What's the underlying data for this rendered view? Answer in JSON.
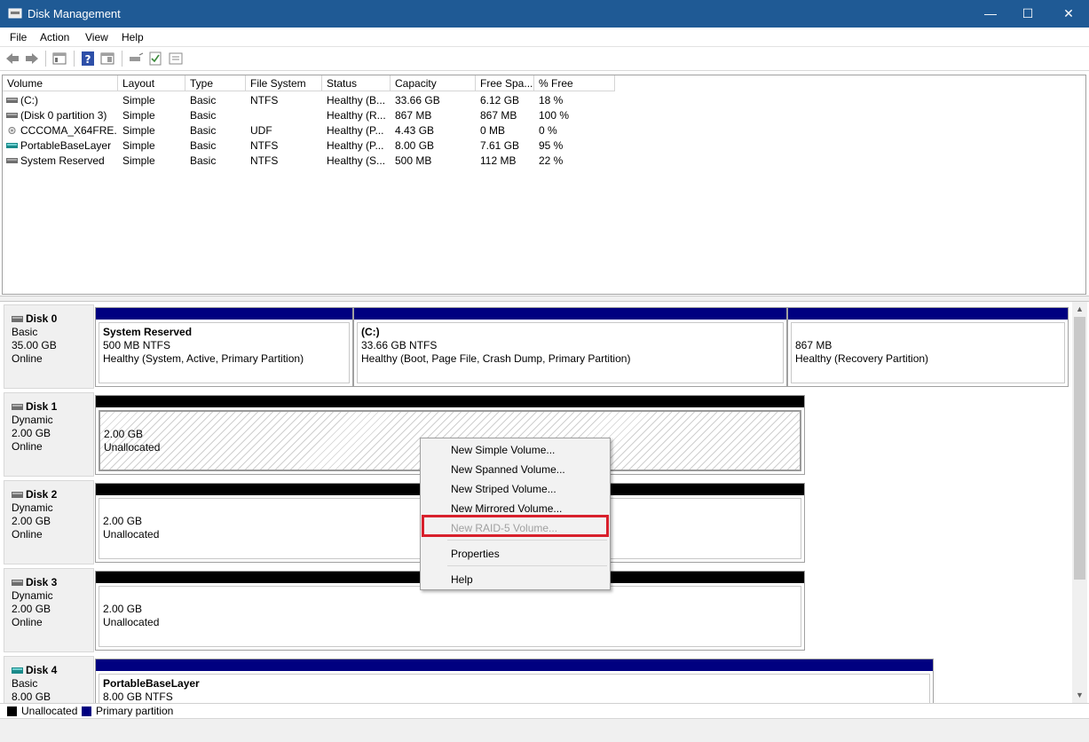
{
  "window": {
    "title": "Disk Management",
    "minimize": "—",
    "maximize": "☐",
    "close": "✕"
  },
  "menu": [
    "File",
    "Action",
    "View",
    "Help"
  ],
  "volume_list": {
    "columns": [
      "Volume",
      "Layout",
      "Type",
      "File System",
      "Status",
      "Capacity",
      "Free Spa...",
      "% Free"
    ],
    "rows": [
      {
        "icon": "drive-icon",
        "volume": "(C:)",
        "layout": "Simple",
        "type": "Basic",
        "fs": "NTFS",
        "status": "Healthy (B...",
        "capacity": "33.66 GB",
        "free": "6.12 GB",
        "pct": "18 %"
      },
      {
        "icon": "drive-icon",
        "volume": "(Disk 0 partition 3)",
        "layout": "Simple",
        "type": "Basic",
        "fs": "",
        "status": "Healthy (R...",
        "capacity": "867 MB",
        "free": "867 MB",
        "pct": "100 %"
      },
      {
        "icon": "dvd-icon",
        "volume": "CCCOMA_X64FRE...",
        "layout": "Simple",
        "type": "Basic",
        "fs": "UDF",
        "status": "Healthy (P...",
        "capacity": "4.43 GB",
        "free": "0 MB",
        "pct": "0 %"
      },
      {
        "icon": "vhd-icon",
        "volume": "PortableBaseLayer",
        "layout": "Simple",
        "type": "Basic",
        "fs": "NTFS",
        "status": "Healthy (P...",
        "capacity": "8.00 GB",
        "free": "7.61 GB",
        "pct": "95 %"
      },
      {
        "icon": "drive-icon",
        "volume": "System Reserved",
        "layout": "Simple",
        "type": "Basic",
        "fs": "NTFS",
        "status": "Healthy (S...",
        "capacity": "500 MB",
        "free": "112 MB",
        "pct": "22 %"
      }
    ]
  },
  "disks": [
    {
      "name": "Disk 0",
      "kind": "Basic",
      "size": "35.00 GB",
      "state": "Online",
      "partitions": [
        {
          "title": "System Reserved",
          "size": "500 MB NTFS",
          "status": "Healthy (System, Active, Primary Partition)"
        },
        {
          "title": "(C:)",
          "size": "33.66 GB NTFS",
          "status": "Healthy (Boot, Page File, Crash Dump, Primary Partition)"
        },
        {
          "title": "",
          "size": "867 MB",
          "status": "Healthy (Recovery Partition)"
        }
      ]
    },
    {
      "name": "Disk 1",
      "kind": "Dynamic",
      "size": "2.00 GB",
      "state": "Online",
      "partitions": [
        {
          "size": "2.00 GB",
          "status": "Unallocated"
        }
      ]
    },
    {
      "name": "Disk 2",
      "kind": "Dynamic",
      "size": "2.00 GB",
      "state": "Online",
      "partitions": [
        {
          "size": "2.00 GB",
          "status": "Unallocated"
        }
      ]
    },
    {
      "name": "Disk 3",
      "kind": "Dynamic",
      "size": "2.00 GB",
      "state": "Online",
      "partitions": [
        {
          "size": "2.00 GB",
          "status": "Unallocated"
        }
      ]
    },
    {
      "name": "Disk 4",
      "kind": "Basic",
      "size": "8.00 GB",
      "state": "",
      "partitions": [
        {
          "title": "PortableBaseLayer",
          "size": "8.00 GB NTFS",
          "status": ""
        }
      ]
    }
  ],
  "legend": [
    {
      "label": "Unallocated",
      "color": "#000000"
    },
    {
      "label": "Primary partition",
      "color": "#000080"
    }
  ],
  "context_menu": {
    "items": [
      {
        "label": "New Simple Volume...",
        "enabled": true
      },
      {
        "label": "New Spanned Volume...",
        "enabled": true
      },
      {
        "label": "New Striped Volume...",
        "enabled": true
      },
      {
        "label": "New Mirrored Volume...",
        "enabled": true
      },
      {
        "label": "New RAID-5 Volume...",
        "enabled": false
      },
      {
        "label": "Properties",
        "enabled": true
      },
      {
        "label": "Help",
        "enabled": true
      }
    ]
  },
  "colors": {
    "titlebar": "#1f5a95",
    "primary": "#000080",
    "unallocated": "#000000",
    "highlight": "#d8202c"
  }
}
